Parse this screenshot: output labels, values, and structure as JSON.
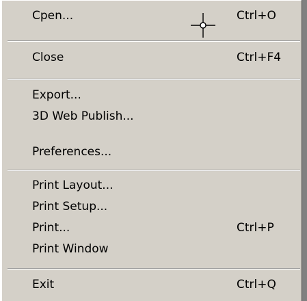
{
  "menu": {
    "items": [
      {
        "label": "Cpen...",
        "shortcut": "Ctrl+O"
      },
      {
        "label": "Close",
        "shortcut": "Ctrl+F4"
      },
      {
        "label": "Export...",
        "shortcut": ""
      },
      {
        "label": "3D Web Publish...",
        "shortcut": ""
      },
      {
        "label": "Preferences...",
        "shortcut": ""
      },
      {
        "label": "Print Layout...",
        "shortcut": ""
      },
      {
        "label": "Print Setup...",
        "shortcut": ""
      },
      {
        "label": "Print...",
        "shortcut": "Ctrl+P"
      },
      {
        "label": "Print Window",
        "shortcut": ""
      },
      {
        "label": "Exit",
        "shortcut": "Ctrl+Q"
      }
    ]
  },
  "icons": {
    "cursor": "crosshair-cursor-icon"
  },
  "colors": {
    "menu_background": "#d4d0c8",
    "text": "#000000",
    "separator_dark": "#a0a0a0",
    "separator_light": "#ffffff"
  }
}
